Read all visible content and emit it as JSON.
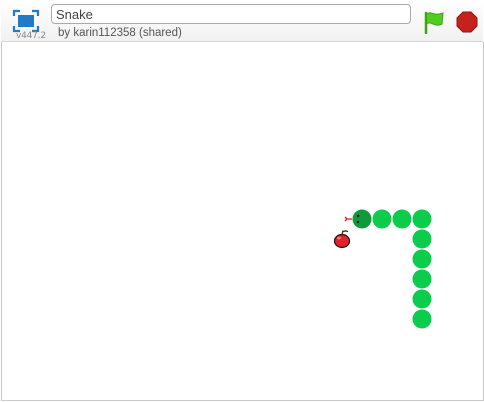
{
  "project": {
    "title": "Snake",
    "author_line": "by karin112358 (shared)",
    "version": "v447.2"
  },
  "controls": {
    "fullscreen_icon": "fullscreen-icon",
    "green_flag_icon": "green-flag-icon",
    "stop_icon": "stop-sign-icon"
  },
  "colors": {
    "snake_body": "#0ccc4c",
    "snake_head": "#119a3d",
    "apple": "#e0232a",
    "flag": "#4fce1d",
    "stop": "#c4221b",
    "fullscreen": "#1f7bc7"
  },
  "stage": {
    "sprites": [
      "snake",
      "apple"
    ]
  }
}
